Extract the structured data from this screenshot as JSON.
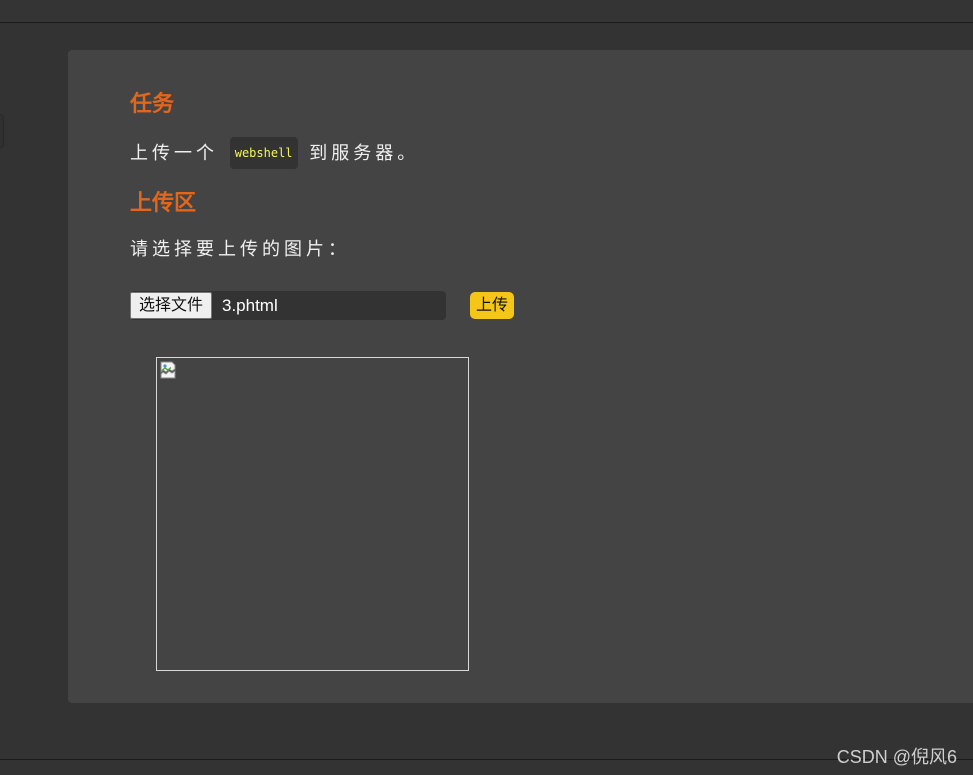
{
  "task": {
    "heading": "任务",
    "text_before": "上传一个",
    "code": "webshell",
    "text_after": "到服务器。"
  },
  "upload": {
    "heading": "上传区",
    "prompt": "请选择要上传的图片：",
    "choose_file_label": "选择文件",
    "file_name": "3.phtml",
    "submit_label": "上传"
  },
  "preview": {
    "icon": "broken-image-icon"
  },
  "watermark": "CSDN @倪风6",
  "colors": {
    "heading": "#e3671b",
    "code_text": "#f5f55a",
    "submit_button": "#f5c518",
    "panel": "#444444",
    "background": "#333333"
  }
}
